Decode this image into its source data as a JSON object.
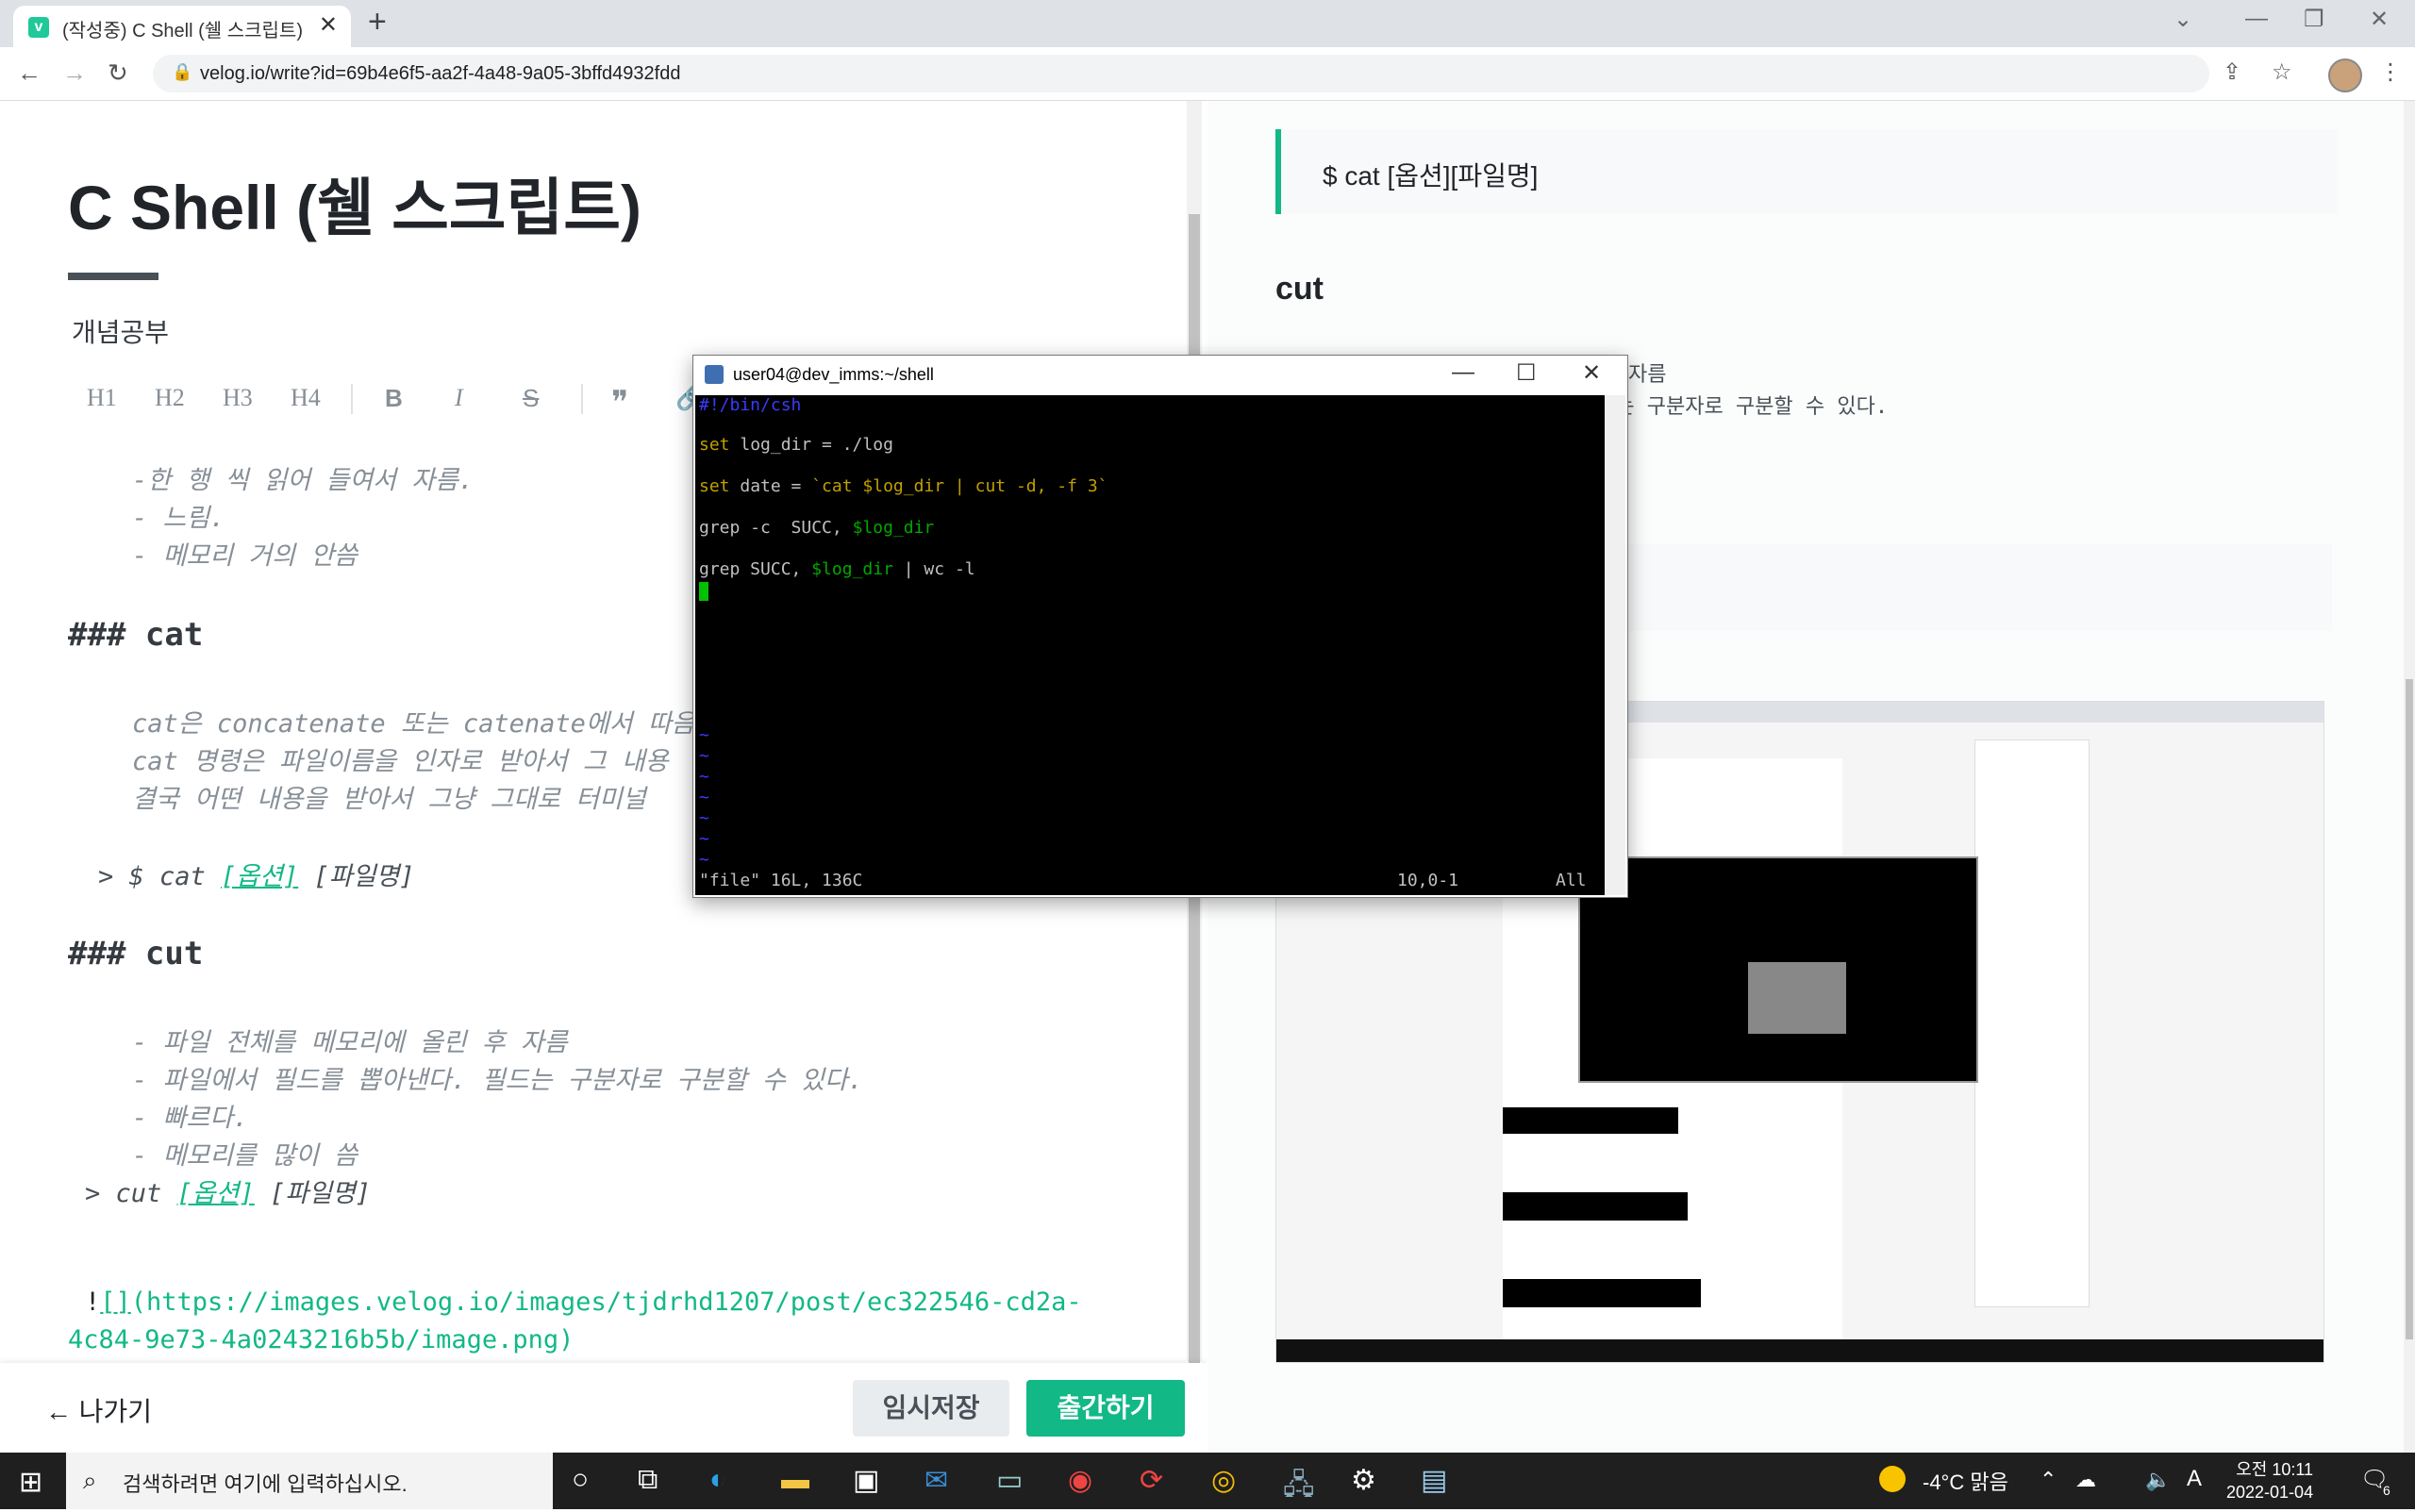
{
  "browser": {
    "tab_title": "(작성중) C Shell (쉘 스크립트)",
    "url": "velog.io/write?id=69b4e6f5-aa2f-4a48-9a05-3bffd4932fdd"
  },
  "editor": {
    "title": "C Shell (쉘 스크립트)",
    "tag": "개념공부",
    "toolbar": [
      "H1",
      "H2",
      "H3",
      "H4",
      "B",
      "I",
      "S",
      "❞",
      "🔗"
    ],
    "lines": {
      "l1": "-한 행 씩 읽어 들여서 자름.",
      "l2": "- 느림.",
      "l3": "- 메모리 거의 안씀",
      "h_cat": "### cat",
      "c1": "cat은 concatenate 또는 catenate에서 따음",
      "c2": "cat 명령은 파일이름을 인자로 받아서 그 내용",
      "c3": "결국 어떤 내용을 받아서 그냥 그대로 터미널",
      "q1_prefix": "> $ cat ",
      "q1_opt": "[옵션]",
      "q1_file": " [파일명]",
      "h_cut": "### cut",
      "u1": "- 파일 전체를 메모리에 올린 후 자름",
      "u2": "- 파일에서 필드를 뽑아낸다. 필드는 구분자로 구분할 수 있다.",
      "u3": "- 빠르다.",
      "u4": "- 메모리를 많이 씀",
      "q2_prefix": "> cut ",
      "q2_opt": "[옵션]",
      "q2_file": " [파일명]",
      "img1_prefix": "!",
      "img1_brk": "[]",
      "img1_rest": "(https://images.velog.io/images/tjdrhd1207/post/ec322546-cd2a-",
      "img2": "4c84-9e73-4a0243216b5b/image.png)"
    },
    "back_label": "나가기",
    "save_label": "임시저장",
    "publish_label": "출간하기"
  },
  "preview": {
    "quote": "$ cat [옵션][파일명]",
    "heading": "cut",
    "t1": "자름",
    "t2": "드는 구분자로 구분할 수 있다."
  },
  "terminal": {
    "title": "user04@dev_imms:~/shell",
    "line0": "#!/bin/csh",
    "line1_kw": "set",
    "line1": " log_dir = ./log",
    "line2_kw": "set",
    "line2_a": " date = ",
    "line2_b": "`cat $log_dir | cut -d, -f 3`",
    "line3_a": "grep -c  SUCC, ",
    "line3_b": "$log_dir",
    "line4_a": "grep SUCC, ",
    "line4_b": "$log_dir",
    "line4_c": " | wc -l",
    "tilde": "~",
    "status_file": "\"file\" 16L, 136C",
    "status_pos": "10,0-1",
    "status_all": "All"
  },
  "taskbar": {
    "search_placeholder": "검색하려면 여기에 입력하십시오.",
    "weather": "-4°C 맑음",
    "time": "오전 10:11",
    "date": "2022-01-04",
    "notif_count": "6"
  }
}
